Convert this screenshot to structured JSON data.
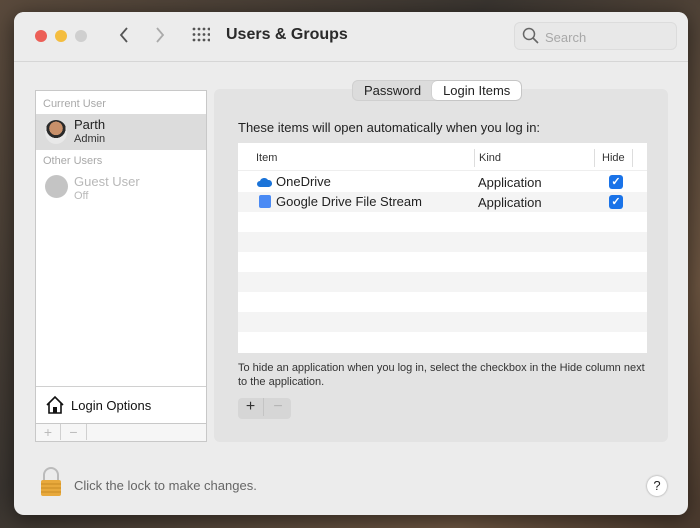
{
  "window": {
    "title": "Users & Groups",
    "search_placeholder": "Search"
  },
  "sidebar": {
    "current_user_header": "Current User",
    "other_users_header": "Other Users",
    "users": [
      {
        "name": "Parth",
        "role": "Admin"
      },
      {
        "name": "Guest User",
        "role": "Off"
      }
    ],
    "login_options": "Login Options",
    "add": "+",
    "remove": "−"
  },
  "tabs": [
    {
      "label": "Password",
      "selected": false
    },
    {
      "label": "Login Items",
      "selected": true
    }
  ],
  "login_items": {
    "intro": "These items will open automatically when you log in:",
    "columns": [
      "Item",
      "Kind",
      "Hide"
    ],
    "rows": [
      {
        "item": "OneDrive",
        "kind": "Application",
        "hide": true
      },
      {
        "item": "Google Drive File Stream",
        "kind": "Application",
        "hide": true
      }
    ],
    "hint": "To hide an application when you log in, select the checkbox in the Hide column next to the application.",
    "add": "+",
    "remove": "−"
  },
  "footer": {
    "lock_text": "Click the lock to make changes.",
    "help": "?"
  },
  "colors": {
    "accent": "#1a73e8",
    "close": "#ec5f57",
    "minimize": "#f4bd3f",
    "lock": "#e8a93c"
  }
}
